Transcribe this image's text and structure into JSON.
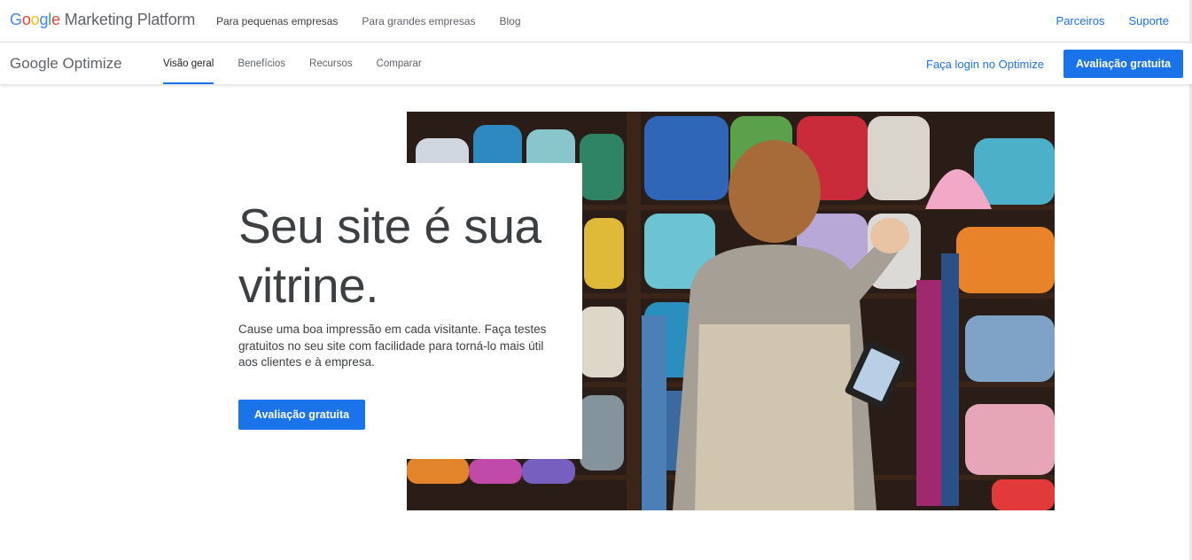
{
  "topbar": {
    "brand_google": [
      "G",
      "o",
      "o",
      "g",
      "l",
      "e"
    ],
    "brand_rest": "Marketing Platform",
    "nav": [
      "Para pequenas empresas",
      "Para grandes empresas",
      "Blog"
    ],
    "right_links": [
      "Parceiros",
      "Suporte"
    ]
  },
  "subbar": {
    "product": "Google Optimize",
    "tabs": [
      "Visão geral",
      "Benefícios",
      "Recursos",
      "Comparar"
    ],
    "active_tab": "Visão geral",
    "login_label": "Faça login no Optimize",
    "trial_label": "Avaliação gratuita"
  },
  "hero": {
    "title_line1": "Seu site é sua",
    "title_line2": "vitrine.",
    "description": "Cause uma boa impressão em cada visitante. Faça testes gratuitos no seu site com facilidade para torná-lo mais útil aos clientes e à empresa.",
    "cta_label": "Avaliação gratuita"
  },
  "colors": {
    "accent": "#1a73e8",
    "text": "#3c4043",
    "muted": "#5f6368"
  }
}
